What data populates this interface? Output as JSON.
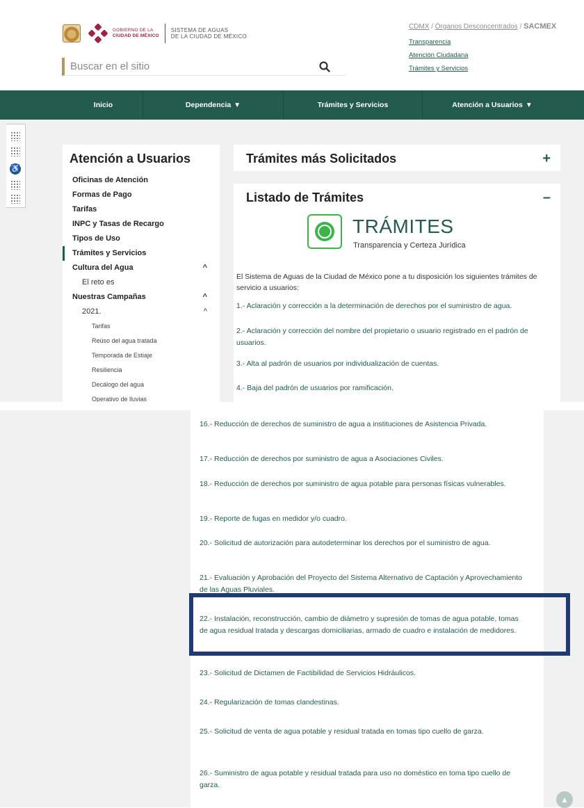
{
  "header": {
    "gob_line1": "GOBIERNO DE LA",
    "gob_line2": "CIUDAD DE MÉXICO",
    "sacmex_line1": "SISTEMA DE AGUAS",
    "sacmex_line2": "DE LA CIUDAD DE MÉXICO",
    "search_placeholder": "Buscar en el sitio",
    "breadcrumb": {
      "cdmx": "CDMX",
      "sep1": " / ",
      "organos": "Órganos Desconcentrados",
      "sep2": " / ",
      "current": "SACMEX"
    },
    "links": [
      "Transparencia",
      "Atención Ciudadana",
      "Trámites y Servicios"
    ]
  },
  "nav": {
    "items": [
      "Inicio",
      "Dependencia",
      "Trámites y Servicios",
      "Atención a Usuarios"
    ],
    "chevron": "⌄"
  },
  "sidebar": {
    "title": "Atención a Usuarios",
    "items": [
      "Oficinas de Atención",
      "Formas de Pago",
      "Tarifas",
      "INPC y Tasas de Recargo",
      "Tipos de Uso",
      "Trámites y Servicios",
      "Cultura del Agua",
      "El reto es",
      "Nuestras Campañas",
      "2021.",
      "Tarifas",
      "Reúso del agua tratada",
      "Temporada de Estiaje",
      "Resiliencia",
      "Decálogo del agua",
      "Operativo de lluvias"
    ]
  },
  "panels": {
    "mas_solicitados": "Trámites más Solicitados",
    "listado": "Listado de Trámites",
    "plus": "+",
    "minus": "–"
  },
  "logo_tramites": {
    "title": "TRÁMITES",
    "subtitle": "Transparencia y Certeza Jurídica"
  },
  "intro": "El Sistema de Aguas de la Ciudad de México pone a tu disposición los siguientes trámites de servicio a usuarios:",
  "procedures_top": [
    "1.- Aclaración y corrección a la determinación de derechos por el suministro de agua.",
    "2.- Aclaración y corrección del nombre del propietario o usuario registrado en el padrón de usuarios.",
    "3.- Alta al padrón de usuarios por individualización de cuentas.",
    "4.- Baja del padrón de usuarios por ramificación."
  ],
  "procedures_bottom": [
    "16.- Reducción de derechos de suministro de agua a instituciones de Asistencia Privada.",
    "17.- Reducción de derechos por suministro de agua a Asociaciones Civiles.",
    "18.- Reducción de derechos por suministro de agua potable para personas físicas vulnerables.",
    "19.- Reporte de fugas en medidor y/o cuadro.",
    "20.- Solicitud de autorización para autodeterminar los derechos por el suministro de agua.",
    "21.- Evaluación y Aprobación del Proyecto del Sistema Alternativo de Captación y Aprovechamiento de las Aguas Pluviales.",
    "22.- Instalación, reconstrucción, cambio de diámetro y supresión de tomas de agua potable, tomas de agua residual tratada y descargas domiciliarias, armado de cuadro e instalación de medidores.",
    "23.- Solicitud de Dictamen de Factibilidad de Servicios Hidráulicos.",
    "24.- Regularización de tomas clandestinas.",
    "25.- Solicitud de venta de agua potable y residual tratada en tomas tipo cuello de garza.",
    "26.- Suministro de agua potable y residual tratada para uso no  doméstico en toma tipo cuello de garza."
  ],
  "colors": {
    "brand_green": "#235b4e",
    "brand_gold": "#b8955a",
    "brand_red": "#9f2241",
    "highlight_frame": "#1f3b74"
  },
  "icons": {
    "search": "search-icon",
    "accessibility": "accessibility-icon",
    "scroll_top": "double-chevron-up-icon"
  }
}
